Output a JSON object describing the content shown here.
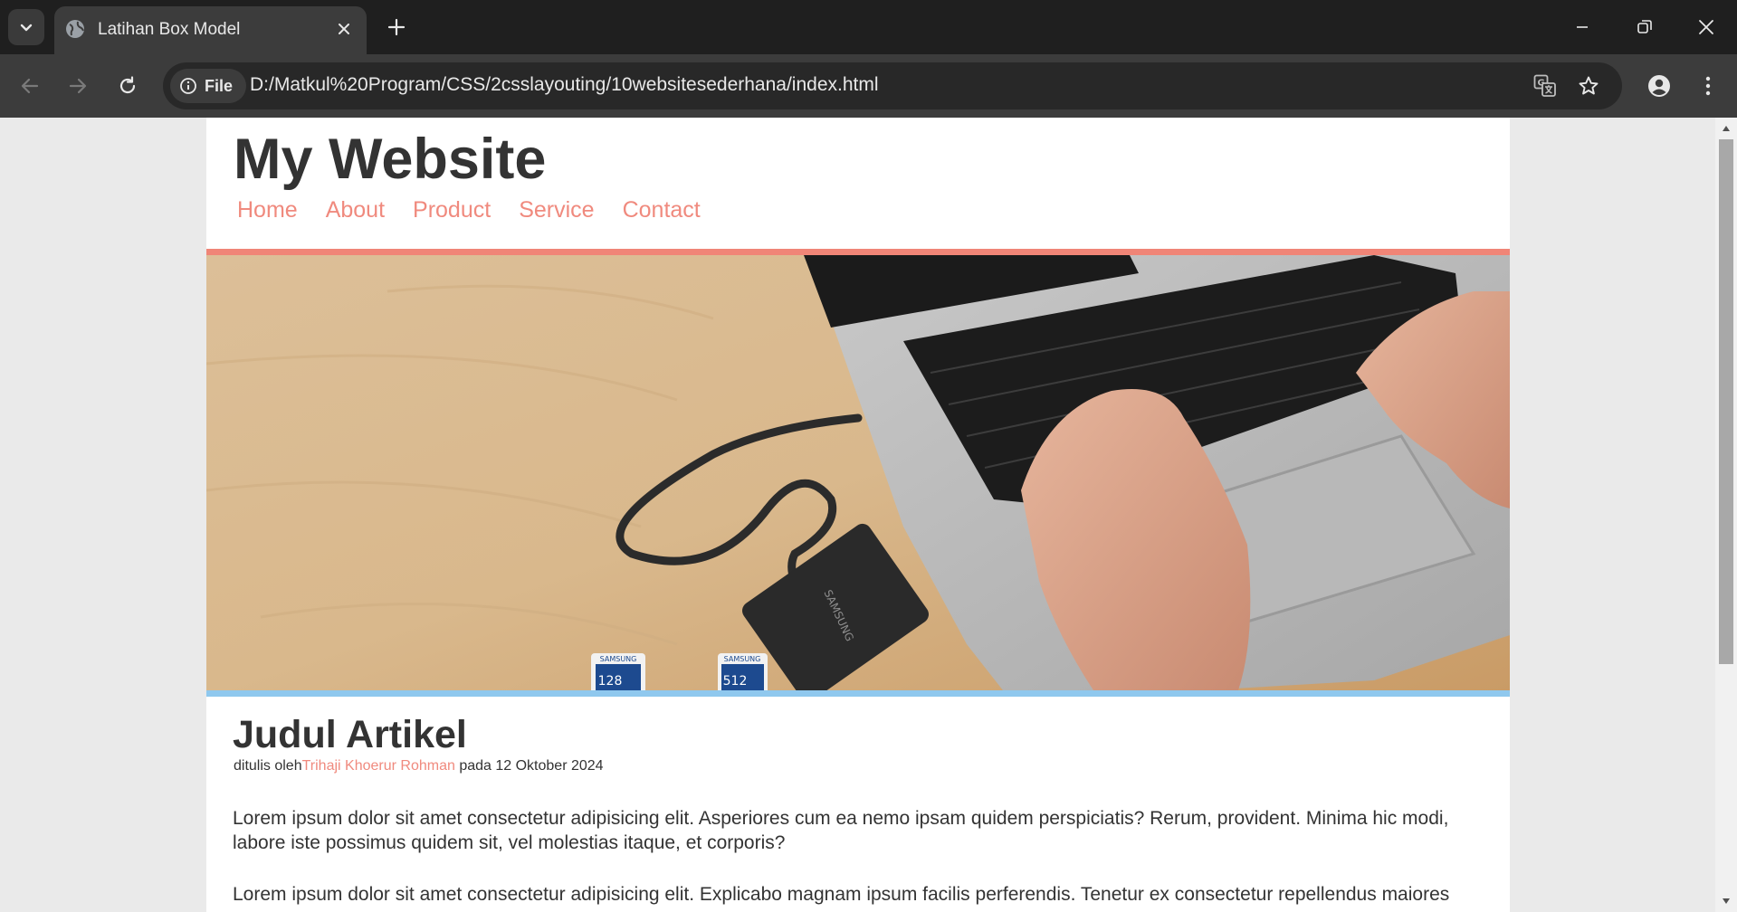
{
  "browser": {
    "tab_title": "Latihan Box Model",
    "chip_label": "File",
    "url": "D:/Matkul%20Program/CSS/2csslayouting/10websitesederhana/index.html"
  },
  "site": {
    "title": "My Website",
    "nav": [
      "Home",
      "About",
      "Product",
      "Service",
      "Contact"
    ],
    "article": {
      "title": "Judul Artikel",
      "meta_prefix": "ditulis oleh",
      "author": "Trihaji Khoerur Rohman",
      "meta_suffix": " pada 12 Oktober 2024",
      "paragraphs": [
        "Lorem ipsum dolor sit amet consectetur adipisicing elit. Asperiores cum ea nemo ipsam quidem perspiciatis? Rerum, provident. Minima hic modi, labore iste possimus quidem sit, vel molestias itaque, et corporis?",
        "Lorem ipsum dolor sit amet consectetur adipisicing elit. Explicabo magnam ipsum facilis perferendis. Tenetur ex consectetur repellendus maiores"
      ]
    },
    "hero_labels": {
      "ssd_brand": "SAMSUNG",
      "card1_brand": "SAMSUNG",
      "card1_size": "128",
      "card2_brand": "SAMSUNG",
      "card2_size": "512"
    }
  },
  "colors": {
    "accent": "#f08a7e",
    "hero_top_border": "#f08577",
    "hero_bottom_border": "#8fc8ee",
    "text": "#333333"
  }
}
